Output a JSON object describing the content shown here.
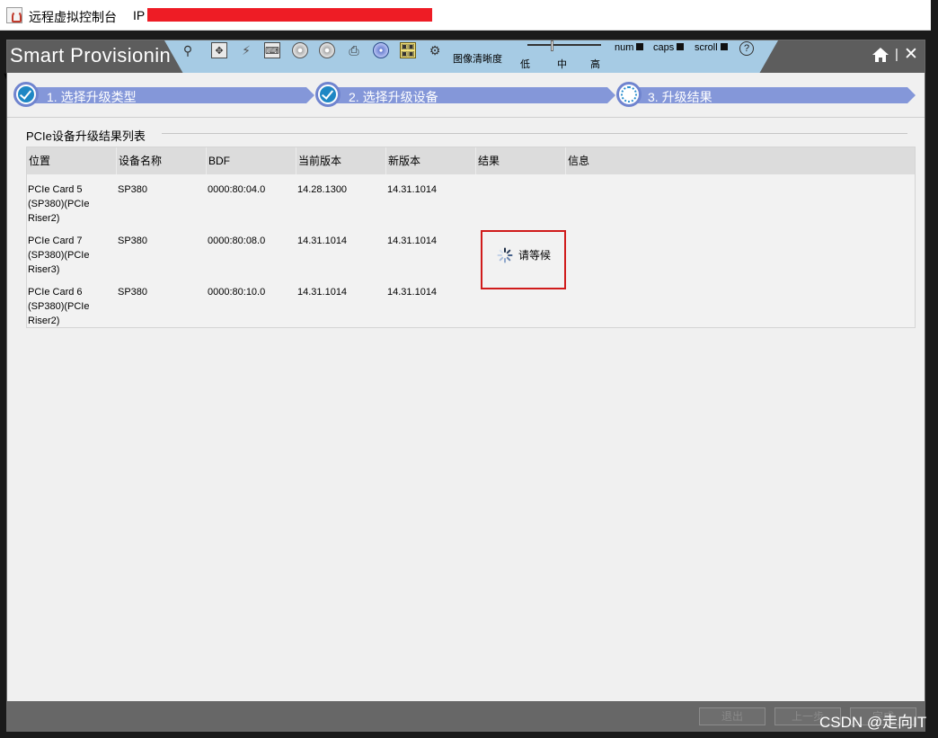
{
  "window": {
    "title": "远程虚拟控制台",
    "ip_label": "IP"
  },
  "app": {
    "brand": "Smart Provisioning"
  },
  "toolbar": {
    "icons": [
      "magnify-icon",
      "move-icon",
      "lightning-icon",
      "keyboard-icon",
      "floppy-icon",
      "disk-icon",
      "printer-icon",
      "cd-icon",
      "grid-icon",
      "settings-icon"
    ],
    "image_quality_label": "图像清晰度",
    "quality_low": "低",
    "quality_mid": "中",
    "quality_high": "高",
    "num_label": "num",
    "caps_label": "caps",
    "scroll_label": "scroll",
    "help_glyph": "?"
  },
  "steps": [
    {
      "label": "1. 选择升级类型",
      "state": "done"
    },
    {
      "label": "2. 选择升级设备",
      "state": "done"
    },
    {
      "label": "3. 升级结果",
      "state": "active"
    }
  ],
  "section": {
    "title": "PCIe设备升级结果列表"
  },
  "table": {
    "headers": [
      "位置",
      "设备名称",
      "BDF",
      "当前版本",
      "新版本",
      "结果",
      "信息"
    ],
    "rows": [
      {
        "location": "PCIe Card 5 (SP380)(PCIe Riser2)",
        "device": "SP380",
        "bdf": "0000:80:04.0",
        "current": "14.28.1300",
        "new": "14.31.1014",
        "result": "",
        "info": ""
      },
      {
        "location": "PCIe Card 7 (SP380)(PCIe Riser3)",
        "device": "SP380",
        "bdf": "0000:80:08.0",
        "current": "14.31.1014",
        "new": "14.31.1014",
        "result": "请等候",
        "info": ""
      },
      {
        "location": "PCIe Card 6 (SP380)(PCIe Riser2)",
        "device": "SP380",
        "bdf": "0000:80:10.0",
        "current": "14.31.1014",
        "new": "14.31.1014",
        "result": "",
        "info": ""
      }
    ]
  },
  "footer": {
    "exit_label": "退出",
    "prev_label": "上一步",
    "next_label": "完成"
  },
  "watermark": "CSDN @走向IT",
  "colors": {
    "step_bar": "#8497d9",
    "toolbar": "#a6cbe4",
    "highlight": "#d01b1b",
    "redaction": "#ee1c25"
  }
}
